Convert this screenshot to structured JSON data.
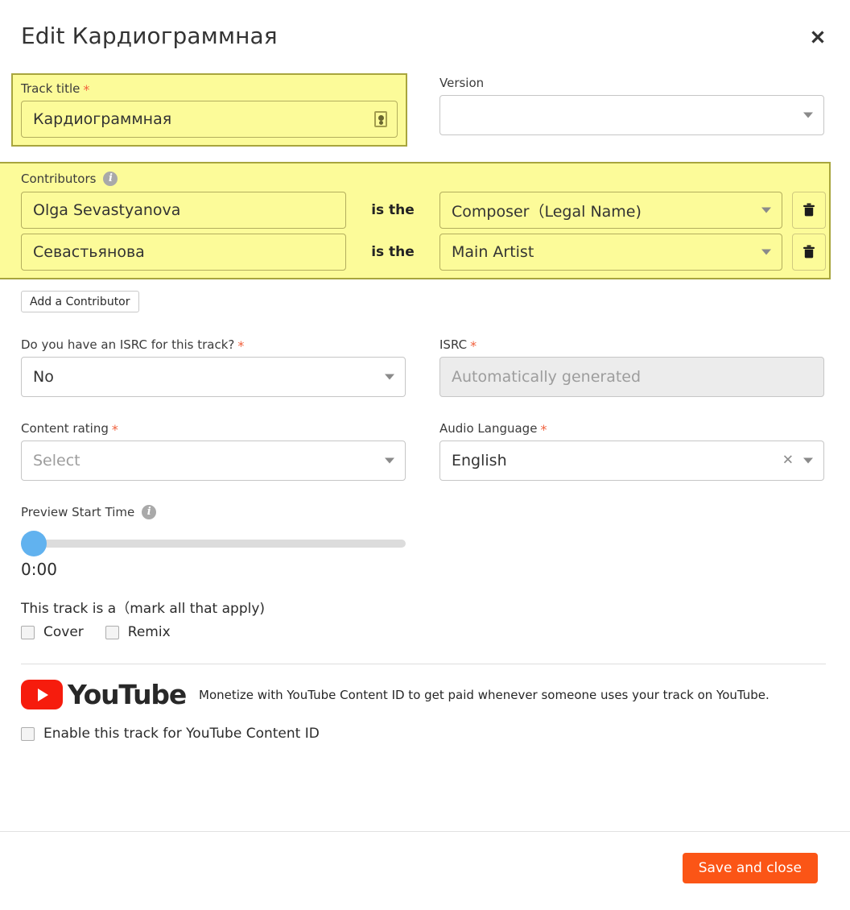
{
  "header": {
    "title": "Edit Кардиограммная",
    "close_icon": "close-icon"
  },
  "track_title": {
    "label": "Track title",
    "required_mark": "*",
    "value": "Кардиограммная",
    "autofill_icon": "contact-card-icon"
  },
  "version": {
    "label": "Version",
    "value": "",
    "caret_icon": "chevron-down-icon"
  },
  "contributors": {
    "label": "Contributors",
    "info_icon": "info-icon",
    "connector": "is the",
    "add_button": "Add a Contributor",
    "delete_icon": "trash-icon",
    "rows": [
      {
        "name": "Olga Sevastyanova",
        "role": "Composer（Legal Name)"
      },
      {
        "name": "Севастьянова",
        "role": "Main Artist"
      }
    ]
  },
  "isrc_question": {
    "label": "Do you have an ISRC for this track?",
    "required_mark": "*",
    "value": "No"
  },
  "isrc": {
    "label": "ISRC",
    "required_mark": "*",
    "placeholder": "Automatically generated",
    "value": ""
  },
  "content_rating": {
    "label": "Content rating",
    "required_mark": "*",
    "placeholder": "Select",
    "value": ""
  },
  "audio_language": {
    "label": "Audio Language",
    "required_mark": "*",
    "value": "English",
    "clear_icon": "close-small-icon"
  },
  "preview_start": {
    "label": "Preview Start Time",
    "info_icon": "info-icon",
    "time": "0:00",
    "slider_percent": 0
  },
  "track_flags": {
    "label": "This track is a（mark all that apply)",
    "options": [
      {
        "label": "Cover",
        "checked": false
      },
      {
        "label": "Remix",
        "checked": false
      }
    ]
  },
  "youtube": {
    "logo_text": "YouTube",
    "play_icon": "play-icon",
    "description": "Monetize with YouTube Content ID to get paid whenever someone uses your track on YouTube.",
    "enable_label": "Enable this track for YouTube Content ID",
    "enable_checked": false
  },
  "footer": {
    "save_label": "Save and close"
  },
  "colors": {
    "accent_orange": "#fb5516",
    "highlight_yellow": "#fcfb99",
    "highlight_border": "#a8a53e",
    "slider_blue": "#61b2ef",
    "required_red": "#f1603c",
    "youtube_red": "#f61c0d"
  }
}
